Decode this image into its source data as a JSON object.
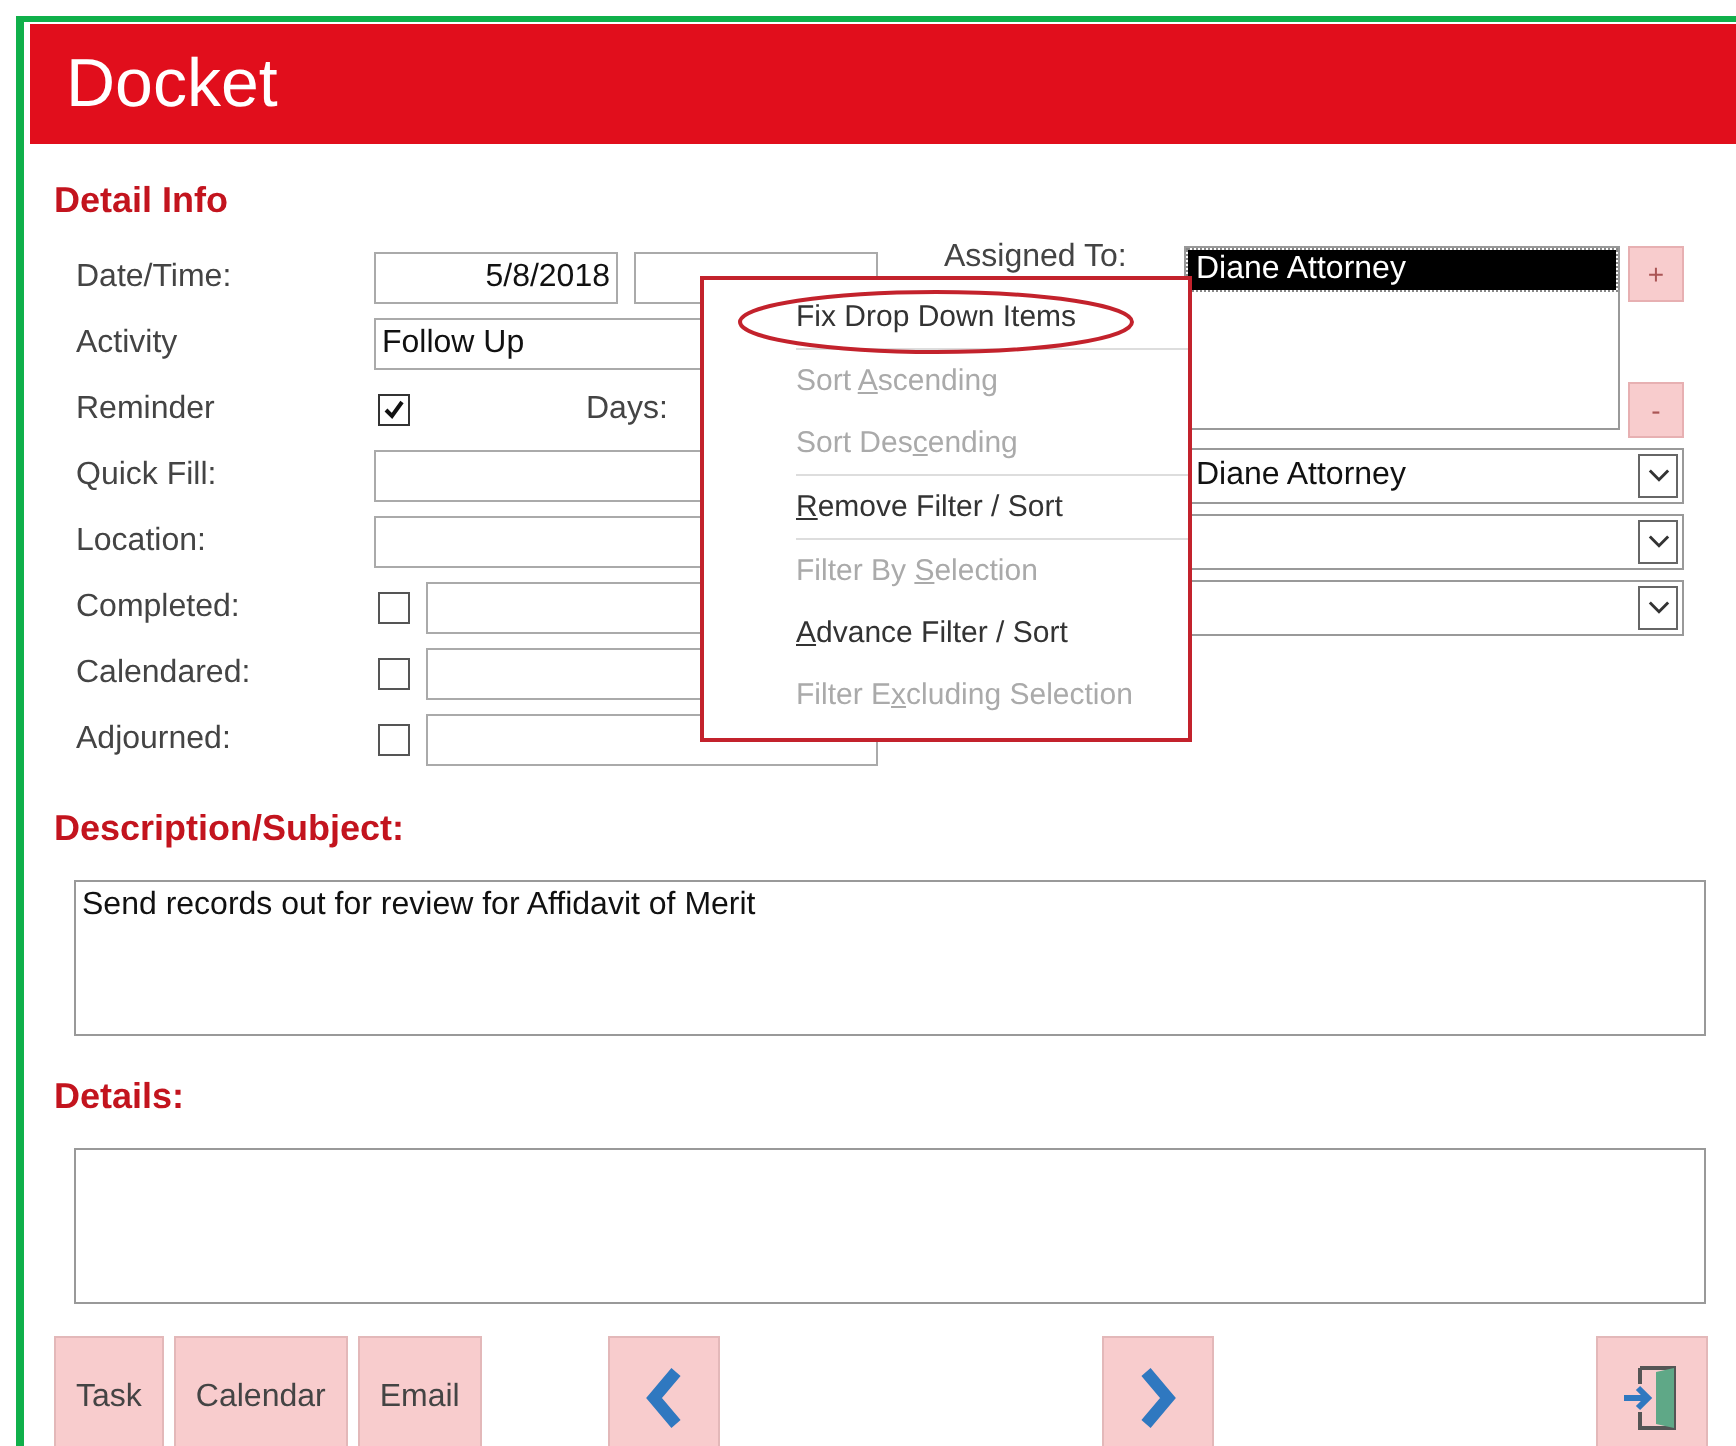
{
  "header": {
    "title": "Docket"
  },
  "detail": {
    "heading": "Detail Info",
    "rows": [
      {
        "kind": "datetime",
        "label": "Date/Time:",
        "date": "5/8/2018",
        "side_combo": false
      },
      {
        "kind": "text",
        "label": "Activity",
        "value": "Follow Up",
        "side_combo": false
      },
      {
        "kind": "reminder",
        "label": "Reminder",
        "checked": true,
        "days_label": "Days:",
        "side_combo": false
      },
      {
        "kind": "text",
        "label": "Quick Fill:",
        "side_combo": true,
        "side_value": "Diane Attorney"
      },
      {
        "kind": "text",
        "label": "Location:",
        "side_combo": true
      },
      {
        "kind": "check",
        "label": "Completed:",
        "checked": false,
        "side_combo": true
      },
      {
        "kind": "check",
        "label": "Calendared:",
        "checked": false,
        "side_combo": false
      },
      {
        "kind": "check",
        "label": "Adjourned:",
        "checked": false,
        "side_combo": false
      }
    ]
  },
  "assigned": {
    "label": "Assigned To:",
    "items": [
      {
        "text": "Diane Attorney",
        "selected": true
      }
    ],
    "add": "+",
    "remove": "-"
  },
  "description": {
    "label": "Description/Subject:",
    "value": "Send records out for review for Affidavit of Merit"
  },
  "details": {
    "label": "Details:"
  },
  "buttons": [
    {
      "kind": "text",
      "label": "Task"
    },
    {
      "kind": "text",
      "label": "Calendar"
    },
    {
      "kind": "text",
      "label": "Email"
    },
    {
      "kind": "previous"
    },
    {
      "kind": "next"
    },
    {
      "kind": "exit"
    }
  ],
  "context_menu": {
    "items": [
      {
        "after": "Fix Drop Down Items",
        "disabled": false,
        "circled": true,
        "separator_after": true
      },
      {
        "before": "Sort ",
        "key": "A",
        "after": "scending",
        "disabled": true,
        "circled": false,
        "separator_after": false
      },
      {
        "before": "Sort Des",
        "key": "c",
        "after": "ending",
        "disabled": true,
        "circled": false,
        "separator_after": true
      },
      {
        "key": "R",
        "after": "emove Filter / Sort",
        "disabled": false,
        "circled": false,
        "separator_after": true
      },
      {
        "before": "Filter By ",
        "key": "S",
        "after": "election",
        "disabled": true,
        "circled": false,
        "separator_after": false
      },
      {
        "key": "A",
        "after": "dvance Filter / Sort",
        "disabled": false,
        "circled": false,
        "separator_after": false
      },
      {
        "before": "Filter E",
        "key": "x",
        "after": "cluding Selection",
        "disabled": true,
        "circled": false,
        "separator_after": false
      }
    ]
  }
}
